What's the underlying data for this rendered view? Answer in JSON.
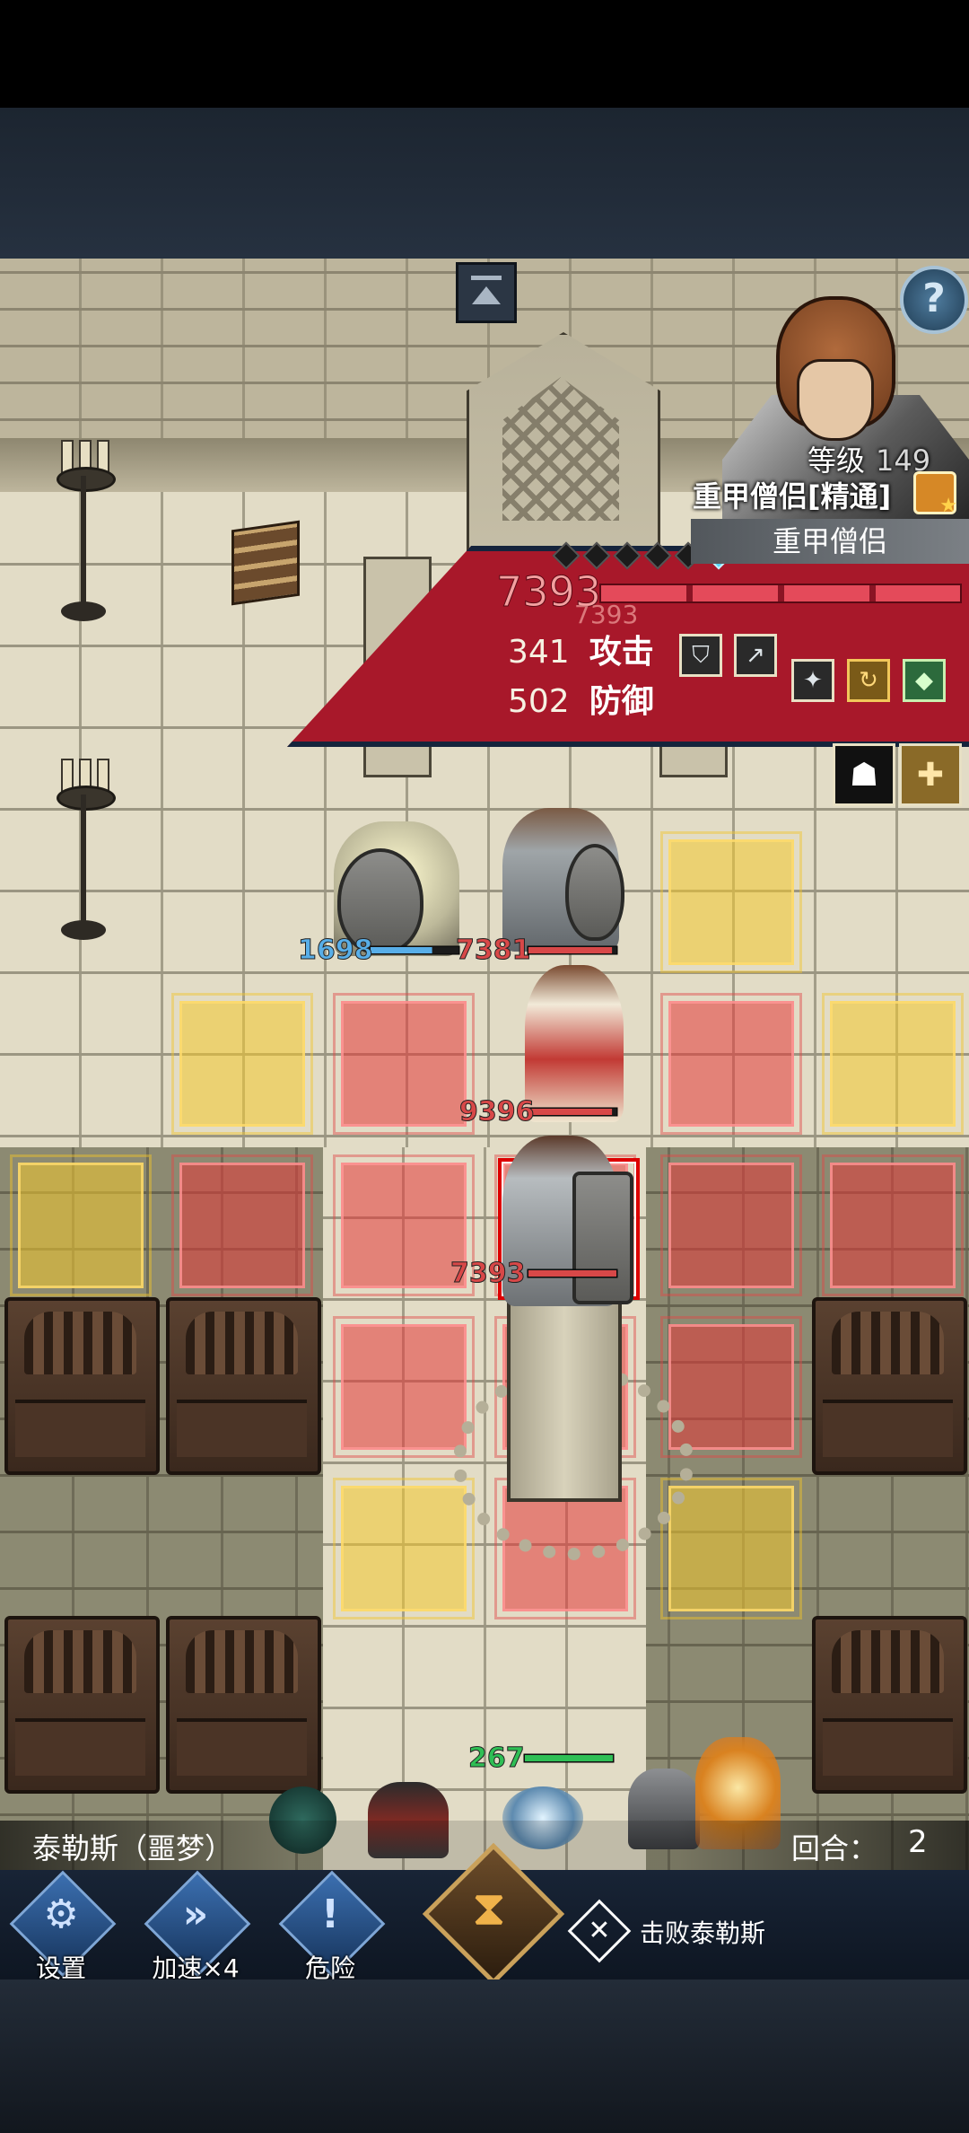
{
  "unit_info": {
    "level_label": "等级",
    "level_value": "149",
    "title": "重甲僧侣[精通]",
    "class_name": "重甲僧侣",
    "hp_value": "7393",
    "hp_ghost": "7393",
    "attack_value": "341",
    "attack_label": "攻击",
    "defense_value": "502",
    "defense_label": "防御",
    "skill_icons": [
      "shield-bash-icon",
      "spear-icon",
      "weapon-buff-icon",
      "whirlwind-icon",
      "green-crystal-icon"
    ],
    "trait_icons": [
      "muscle-icon",
      "healing-icon"
    ]
  },
  "board": {
    "units": [
      {
        "name": "paladin-ally",
        "hp": "1698",
        "hp_fraction": 0.7,
        "hp_color": "#58aee8"
      },
      {
        "name": "knight-enemy",
        "hp": "7381",
        "hp_fraction": 0.95,
        "hp_color": "#d84848"
      },
      {
        "name": "cleric-enemy",
        "hp": "9396",
        "hp_fraction": 0.95,
        "hp_color": "#d84848"
      },
      {
        "name": "heavy-monk-enemy",
        "hp": "7393",
        "hp_fraction": 1.0,
        "hp_color": "#d84848"
      },
      {
        "name": "obelisk-totem",
        "hp": "267",
        "hp_fraction": 1.0,
        "hp_color": "#2fbf55"
      }
    ]
  },
  "status": {
    "boss_name": "泰勒斯（噩梦）",
    "round_label": "回合：",
    "round_value": "2"
  },
  "actions": {
    "settings_label": "设置",
    "speed_label": "加速×4",
    "danger_label": "危险",
    "objective_text": "击败泰勒斯"
  },
  "colors": {
    "panel_red": "#a8182a",
    "tile_red": "#e43838",
    "tile_yellow": "#f2c82d"
  }
}
